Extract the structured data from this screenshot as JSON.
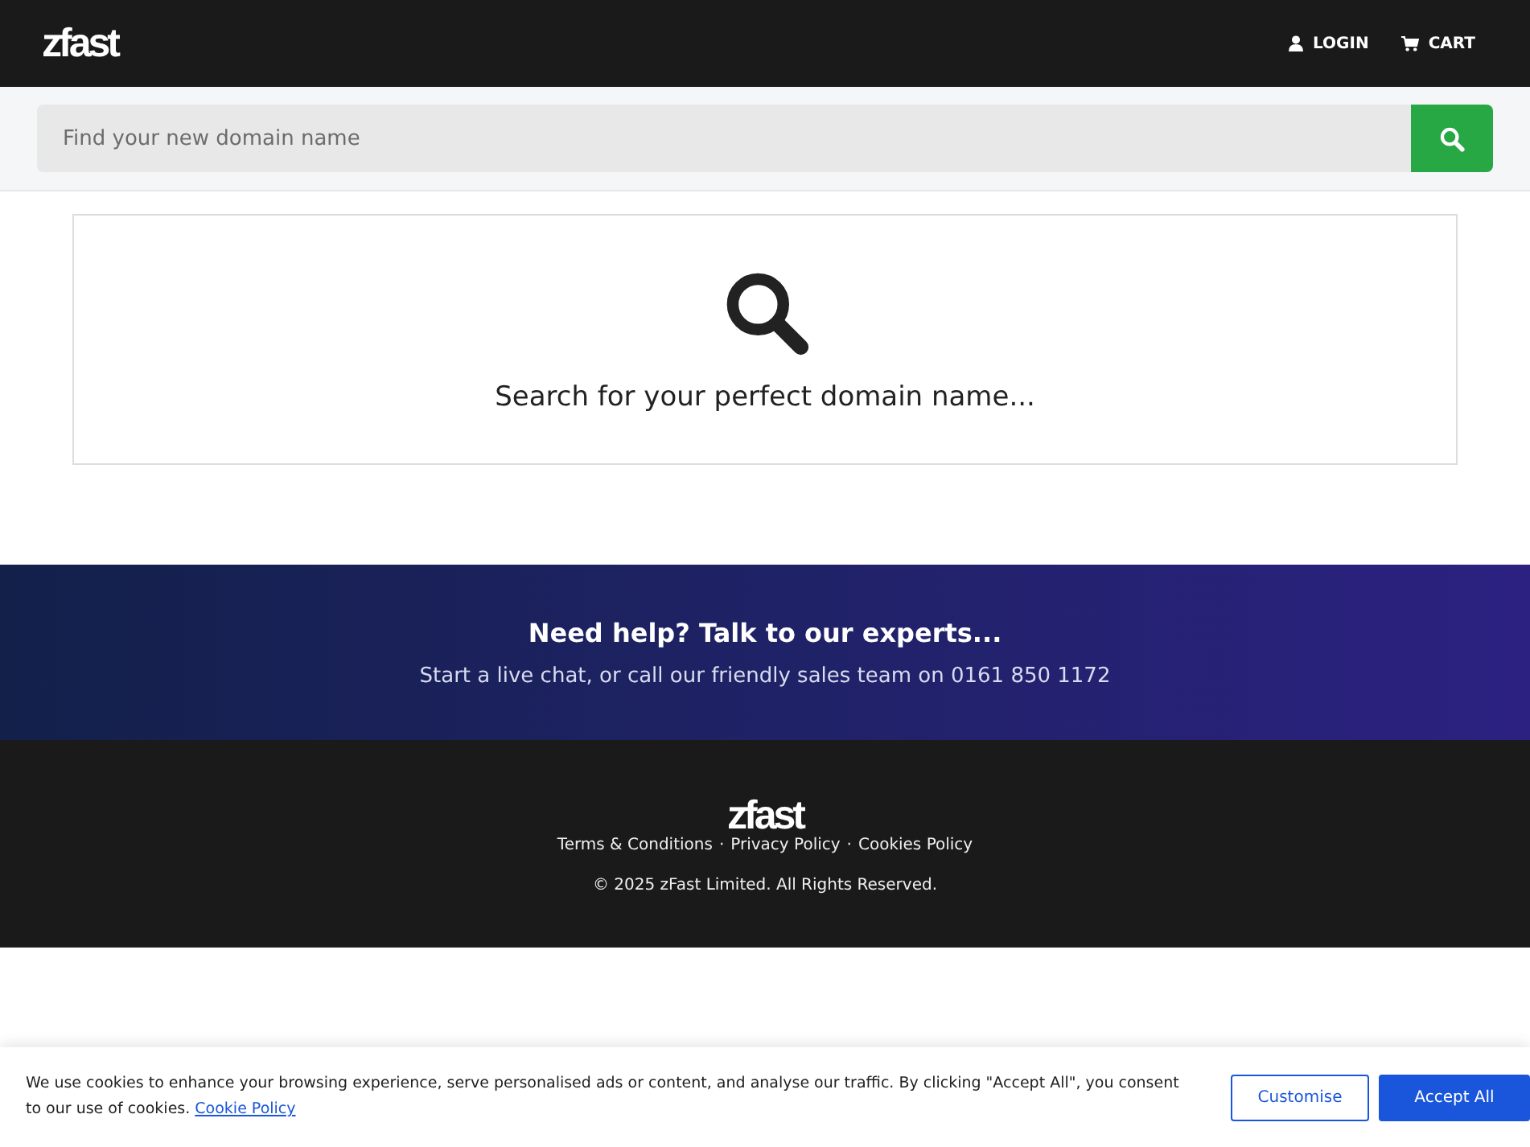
{
  "header": {
    "logo": "zfast",
    "nav": [
      {
        "kind": "user",
        "label": "LOGIN"
      },
      {
        "kind": "cart",
        "label": "CART"
      }
    ]
  },
  "search": {
    "placeholder": "Find your new domain name"
  },
  "prompt": {
    "text": "Search for your perfect domain name..."
  },
  "help": {
    "title": "Need help? Talk to our experts...",
    "subtitle": "Start a live chat, or call our friendly sales team on 0161 850 1172"
  },
  "footer": {
    "logo": "zfast",
    "links": [
      "Terms & Conditions",
      "Privacy Policy",
      "Cookies Policy"
    ],
    "separator": "·",
    "copyright": "© 2025 zFast Limited. All Rights Reserved."
  },
  "cookie_banner": {
    "text": "We use cookies to enhance your browsing experience, serve personalised ads or content, and analyse our traffic. By clicking \"Accept All\", you consent to our use of cookies.",
    "link": "Cookie Policy",
    "buttons": [
      {
        "kind": "outline",
        "label": "Customise"
      },
      {
        "kind": "solid",
        "label": "Accept All"
      }
    ]
  }
}
